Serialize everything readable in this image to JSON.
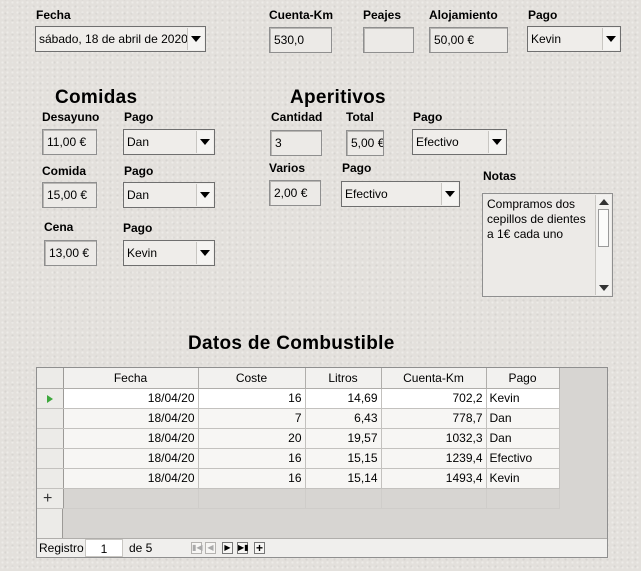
{
  "top": {
    "fecha": {
      "label": "Fecha",
      "value": "sábado, 18 de abril de 2020"
    },
    "cuenta_km": {
      "label": "Cuenta-Km",
      "value": "530,0"
    },
    "peajes": {
      "label": "Peajes",
      "value": ""
    },
    "alojamiento": {
      "label": "Alojamiento",
      "value": "50,00 €"
    },
    "pago": {
      "label": "Pago",
      "value": "Kevin"
    }
  },
  "comidas": {
    "title": "Comidas",
    "desayuno": {
      "label": "Desayuno",
      "value": "11,00 €",
      "pago_label": "Pago",
      "pago": "Dan"
    },
    "comida": {
      "label": "Comida",
      "value": "15,00 €",
      "pago_label": "Pago",
      "pago": "Dan"
    },
    "cena": {
      "label": "Cena",
      "value": "13,00 €",
      "pago_label": "Pago",
      "pago": "Kevin"
    }
  },
  "aperitivos": {
    "title": "Aperitivos",
    "cantidad": {
      "label": "Cantidad",
      "value": "3"
    },
    "total": {
      "label": "Total",
      "value": "5,00 €"
    },
    "pago": {
      "label": "Pago",
      "value": "Efectivo"
    },
    "varios": {
      "label": "Varios",
      "value": "2,00 €"
    },
    "varios_pago": {
      "label": "Pago",
      "value": "Efectivo"
    }
  },
  "notas": {
    "label": "Notas",
    "value": "Compramos dos cepillos de dientes a 1€ cada uno"
  },
  "combustible": {
    "title": "Datos de Combustible",
    "columns": [
      "Fecha",
      "Coste",
      "Litros",
      "Cuenta-Km",
      "Pago"
    ],
    "rows": [
      [
        "18/04/20",
        "16",
        "14,69",
        "702,2",
        "Kevin"
      ],
      [
        "18/04/20",
        "7",
        "6,43",
        "778,7",
        "Dan"
      ],
      [
        "18/04/20",
        "20",
        "19,57",
        "1032,3",
        "Dan"
      ],
      [
        "18/04/20",
        "16",
        "15,15",
        "1239,4",
        "Efectivo"
      ],
      [
        "18/04/20",
        "16",
        "15,14",
        "1493,4",
        "Kevin"
      ]
    ],
    "nav": {
      "registro_label": "Registro",
      "current": "1",
      "of_label": "de 5"
    }
  },
  "icons": {
    "dropdown": "chevron-down-icon",
    "row_pointer": "current-row-icon",
    "new_row": "plus-icon",
    "nav": [
      "first-record-icon",
      "previous-record-icon",
      "next-record-icon",
      "last-record-icon",
      "new-record-icon"
    ]
  }
}
